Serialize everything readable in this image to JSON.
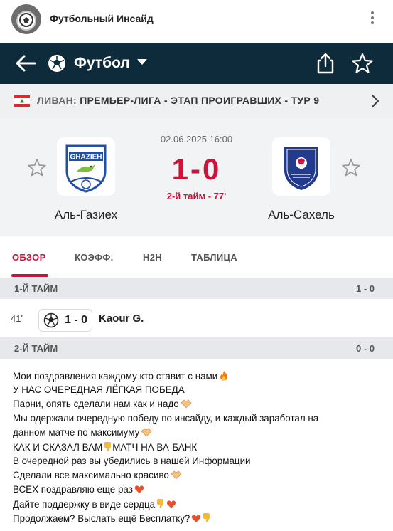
{
  "channel": {
    "name": "Футбольный Инсайд"
  },
  "appbar": {
    "title": "Футбол"
  },
  "league": {
    "country": "ЛИВАН:",
    "name": "ПРЕМЬЕР-ЛИГА - ЭТАП ПРОИГРАВШИХ - ТУР 9"
  },
  "match": {
    "date": "02.06.2025 16:00",
    "score": "1-0",
    "status": "2-й тайм - 77'",
    "home": {
      "name": "Аль-Газиех"
    },
    "away": {
      "name": "Аль-Сахель"
    }
  },
  "tabs": [
    "ОБЗОР",
    "КОЭФФ.",
    "H2H",
    "ТАБЛИЦА"
  ],
  "sections": [
    {
      "title": "1-Й ТАЙМ",
      "score": "1 - 0"
    },
    {
      "title": "2-Й ТАЙМ",
      "score": "0 - 0"
    }
  ],
  "event": {
    "minute": "41'",
    "score": "1 - 0",
    "player": "Kaour G."
  },
  "message": {
    "lines": [
      "Мои поздравления каждому кто ставит с нами",
      "У НАС ОЧЕРЕДНАЯ ЛЁГКАЯ ПОБЕДА",
      "Парни, опять сделали нам как и надо",
      "Мы одержали очередную победу по инсайду, и каждый заработал на",
      "данном матче по максимуму",
      "КАК И СКАЗАЛ ВАМ",
      "МАТЧ НА ВА-БАНК",
      "В очередной раз вы убедились в нашей Информации",
      "Сделали все максимально красиво",
      "ВСЕХ поздравляю еще раз",
      "Дайте поддержку в виде сердца",
      "Продолжаем? Выслать ещё Бесплатку?"
    ]
  },
  "colors": {
    "accent": "#d0113b",
    "appbar": "#0e2b3b",
    "section_bg": "#e6e8eb"
  }
}
